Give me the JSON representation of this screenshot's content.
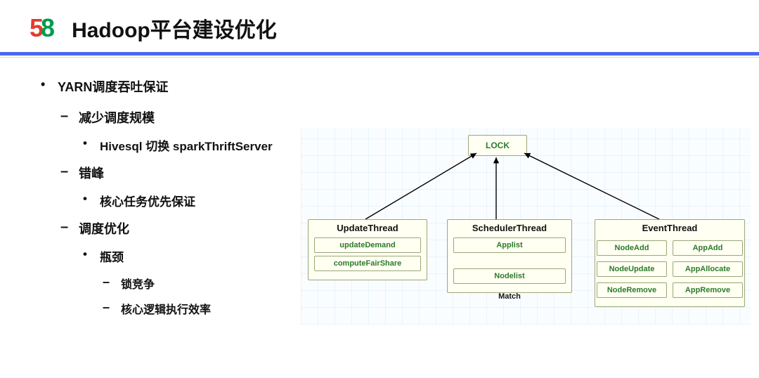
{
  "logo": {
    "five": "5",
    "eight": "8"
  },
  "title": "Hadoop平台建设优化",
  "bullets": {
    "b1": "YARN调度吞吐保证",
    "b1_1": "减少调度规模",
    "b1_1_1": "Hivesql 切换 sparkThriftServer",
    "b1_2": "错峰",
    "b1_2_1": "核心任务优先保证",
    "b1_3": "调度优化",
    "b1_3_1": "瓶颈",
    "b1_3_1_1": "锁竞争",
    "b1_3_1_2": "核心逻辑执行效率"
  },
  "diagram": {
    "lock": "LOCK",
    "update": {
      "title": "UpdateThread",
      "chips": [
        "updateDemand",
        "computeFairShare"
      ]
    },
    "scheduler": {
      "title": "SchedulerThread",
      "applist": "Applist",
      "nodelist": "Nodelist",
      "match": "Match"
    },
    "event": {
      "title": "EventThread",
      "left": [
        "NodeAdd",
        "NodeUpdate",
        "NodeRemove"
      ],
      "right": [
        "AppAdd",
        "AppAllocate",
        "AppRemove"
      ]
    }
  }
}
